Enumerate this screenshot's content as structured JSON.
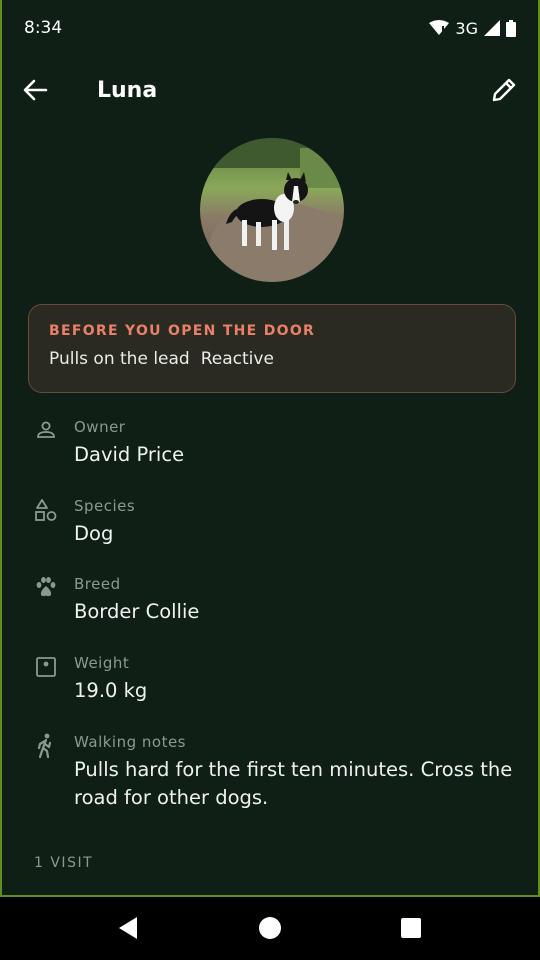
{
  "status_bar": {
    "time": "8:34",
    "network": "3G",
    "icons": [
      "wifi-icon",
      "signal-icon",
      "battery-icon"
    ]
  },
  "app_bar": {
    "title": "Luna",
    "back_icon": "arrow-back-icon",
    "edit_icon": "pencil-icon"
  },
  "alert": {
    "title": "BEFORE YOU OPEN THE DOOR",
    "tags": [
      "Pulls on the lead",
      "Reactive"
    ],
    "color": "#e9806b"
  },
  "details": [
    {
      "icon": "person-icon",
      "label": "Owner",
      "value": "David Price"
    },
    {
      "icon": "shapes-icon",
      "label": "Species",
      "value": "Dog"
    },
    {
      "icon": "paw-icon",
      "label": "Breed",
      "value": "Border Collie"
    },
    {
      "icon": "scale-icon",
      "label": "Weight",
      "value": "19.0 kg"
    },
    {
      "icon": "walking-icon",
      "label": "Walking notes",
      "value": "Pulls hard for the first ten minutes. Cross the road for other dogs."
    }
  ],
  "visits_label": "1 VISIT",
  "colors": {
    "background": "#0f1f16",
    "accent_border": "#5e8f1f",
    "alert_text": "#e9806b"
  }
}
